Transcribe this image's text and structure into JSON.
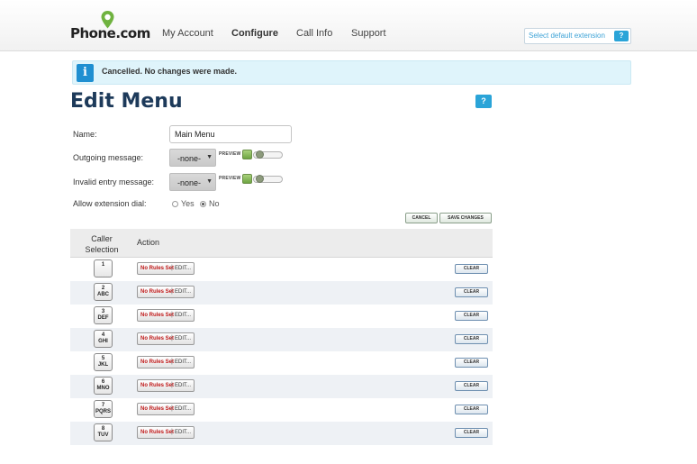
{
  "header": {
    "logo_text": "Phone.com",
    "nav": [
      "My Account",
      "Configure",
      "Call Info",
      "Support"
    ],
    "extension_button": "Select default extension",
    "extension_help": "?"
  },
  "alert": {
    "icon": "i",
    "message": "Cancelled. No changes were made."
  },
  "page": {
    "title": "Edit Menu",
    "help": "?"
  },
  "form": {
    "name_label": "Name:",
    "name_value": "Main Menu",
    "outgoing_label": "Outgoing message:",
    "outgoing_value": "-none-",
    "invalid_label": "Invalid entry message:",
    "invalid_value": "-none-",
    "preview_label": "PREVIEW",
    "allow_label": "Allow extension dial:",
    "allow_options": [
      "Yes",
      "No"
    ],
    "allow_selected": "No",
    "cancel_label": "CANCEL",
    "save_label": "SAVE CHANGES"
  },
  "table": {
    "col_caller": "Caller Selection",
    "col_action": "Action",
    "rule_text": "No Rules Set",
    "edit_text": "EDIT...",
    "clear_text": "CLEAR",
    "rows": [
      {
        "num": "1",
        "letters": ""
      },
      {
        "num": "2",
        "letters": "ABC"
      },
      {
        "num": "3",
        "letters": "DEF"
      },
      {
        "num": "4",
        "letters": "GHI"
      },
      {
        "num": "5",
        "letters": "JKL"
      },
      {
        "num": "6",
        "letters": "MNO"
      },
      {
        "num": "7",
        "letters": "PQRS"
      },
      {
        "num": "8",
        "letters": "TUV"
      }
    ]
  },
  "colors": {
    "title": "#1d3a5a",
    "accent": "#2aa4d8",
    "alert_bg": "#dff4fb",
    "rule_red": "#c01818",
    "logo_green": "#6fb23f"
  },
  "icons": {
    "logo": "location-pin-icon",
    "alert": "info-icon",
    "help": "question-icon",
    "preview": "play-icon"
  }
}
